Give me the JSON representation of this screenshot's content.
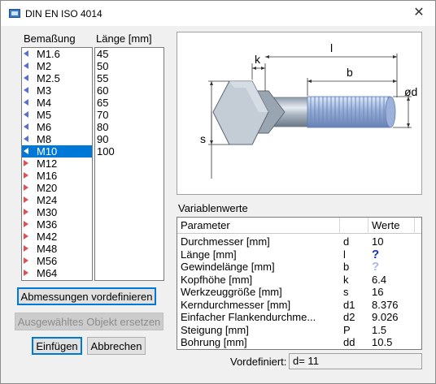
{
  "window": {
    "title": "DIN EN ISO 4014",
    "close_glyph": "✕"
  },
  "size_list": {
    "header": "Bemaßung",
    "items": [
      {
        "label": "M1.6",
        "arrow": "left"
      },
      {
        "label": "M2",
        "arrow": "left"
      },
      {
        "label": "M2.5",
        "arrow": "left"
      },
      {
        "label": "M3",
        "arrow": "left"
      },
      {
        "label": "M4",
        "arrow": "left"
      },
      {
        "label": "M5",
        "arrow": "left"
      },
      {
        "label": "M6",
        "arrow": "left"
      },
      {
        "label": "M8",
        "arrow": "left"
      },
      {
        "label": "M10",
        "arrow": "left",
        "selected": true
      },
      {
        "label": "M12",
        "arrow": "right"
      },
      {
        "label": "M16",
        "arrow": "right"
      },
      {
        "label": "M20",
        "arrow": "right"
      },
      {
        "label": "M24",
        "arrow": "right"
      },
      {
        "label": "M30",
        "arrow": "right"
      },
      {
        "label": "M36",
        "arrow": "right"
      },
      {
        "label": "M42",
        "arrow": "right"
      },
      {
        "label": "M48",
        "arrow": "right"
      },
      {
        "label": "M56",
        "arrow": "right"
      },
      {
        "label": "M64",
        "arrow": "right"
      }
    ]
  },
  "length_list": {
    "header": "Länge [mm]",
    "items": [
      "45",
      "50",
      "55",
      "60",
      "65",
      "70",
      "80",
      "90",
      "100"
    ]
  },
  "buttons": {
    "predefine": "Abmessungen vordefinieren",
    "replace": "Ausgewähltes Objekt ersetzen",
    "insert": "Einfügen",
    "cancel": "Abbrechen"
  },
  "drawing": {
    "label_k": "k",
    "label_l": "l",
    "label_b": "b",
    "label_d": "ød",
    "label_s": "s"
  },
  "variables": {
    "title": "Variablenwerte",
    "columns": [
      "Parameter",
      "",
      "Werte"
    ],
    "rows": [
      {
        "param": "Durchmesser [mm]",
        "symbol": "d",
        "value": "10"
      },
      {
        "param": "Länge [mm]",
        "symbol": "l",
        "value": "?",
        "value_style": "qmark"
      },
      {
        "param": "Gewindelänge [mm]",
        "symbol": "b",
        "value": "?",
        "value_style": "qmark-light"
      },
      {
        "param": "Kopfhöhe [mm]",
        "symbol": "k",
        "value": "6.4"
      },
      {
        "param": "Werkzeuggröße [mm]",
        "symbol": "s",
        "value": "16"
      },
      {
        "param": "Kerndurchmesser [mm]",
        "symbol": "d1",
        "value": "8.376"
      },
      {
        "param": "Einfacher Flankendurchme...",
        "symbol": "d2",
        "value": "9.026"
      },
      {
        "param": "Steigung [mm]",
        "symbol": "P",
        "value": "1.5"
      },
      {
        "param": "Bohrung [mm]",
        "symbol": "dd",
        "value": "10.5"
      }
    ]
  },
  "predefined": {
    "label": "Vordefiniert:",
    "value": "d= 11"
  },
  "colors": {
    "selection": "#0078d7",
    "arrow_left": "#5a6fd6",
    "arrow_right": "#e05050",
    "bolt": "#aeb8c4"
  }
}
